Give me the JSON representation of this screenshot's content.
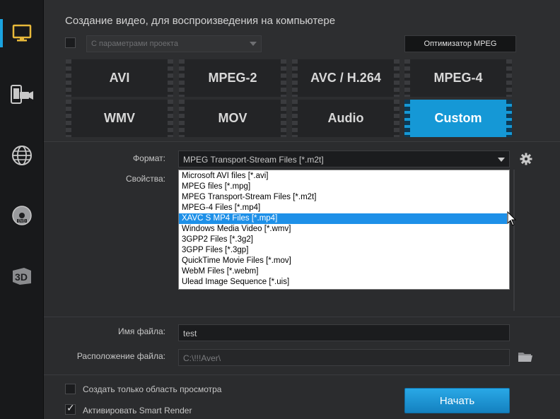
{
  "sidebar": {
    "items": [
      {
        "icon": "monitor-icon",
        "active": true
      },
      {
        "icon": "devices-icon",
        "active": false
      },
      {
        "icon": "globe-icon",
        "active": false
      },
      {
        "icon": "dvd-icon",
        "active": false
      },
      {
        "icon": "3d-icon",
        "active": false,
        "text": "3D"
      }
    ]
  },
  "header": {
    "title": "Создание видео, для воспроизведения на компьютере"
  },
  "profile": {
    "checked": false,
    "placeholder": "С параметрами проекта",
    "optimizer_label": "Оптимизатор MPEG"
  },
  "formats": [
    "AVI",
    "MPEG-2",
    "AVC / H.264",
    "MPEG-4",
    "WMV",
    "MOV",
    "Audio",
    "Custom"
  ],
  "selected_format": "Custom",
  "settings": {
    "format_label": "Формат:",
    "format_value": "MPEG Transport-Stream Files [*.m2t]",
    "properties_label": "Свойства:",
    "dropdown_options": [
      "Microsoft AVI files [*.avi]",
      "MPEG files [*.mpg]",
      "MPEG Transport-Stream Files [*.m2t]",
      "MPEG-4 Files [*.mp4]",
      "XAVC S MP4 Files [*.mp4]",
      "Windows Media Video [*.wmv]",
      "3GPP2 Files [*.3g2]",
      "3GPP Files [*.3gp]",
      "QuickTime Movie Files [*.mov]",
      "WebM Files [*.webm]",
      "Ulead Image Sequence [*.uis]"
    ],
    "highlighted_option": "XAVC S MP4 Files [*.mp4]"
  },
  "file": {
    "name_label": "Имя файла:",
    "name_value": "test",
    "location_label": "Расположение файла:",
    "location_value": "C:\\!!!Aver\\"
  },
  "options": {
    "preview_only_label": "Создать только область просмотра",
    "preview_only_checked": false,
    "smart_render_label": "Активировать Smart Render",
    "smart_render_checked": true
  },
  "actions": {
    "start_label": "Начать"
  },
  "colors": {
    "accent": "#1598d6",
    "highlight": "#1e90e8"
  }
}
